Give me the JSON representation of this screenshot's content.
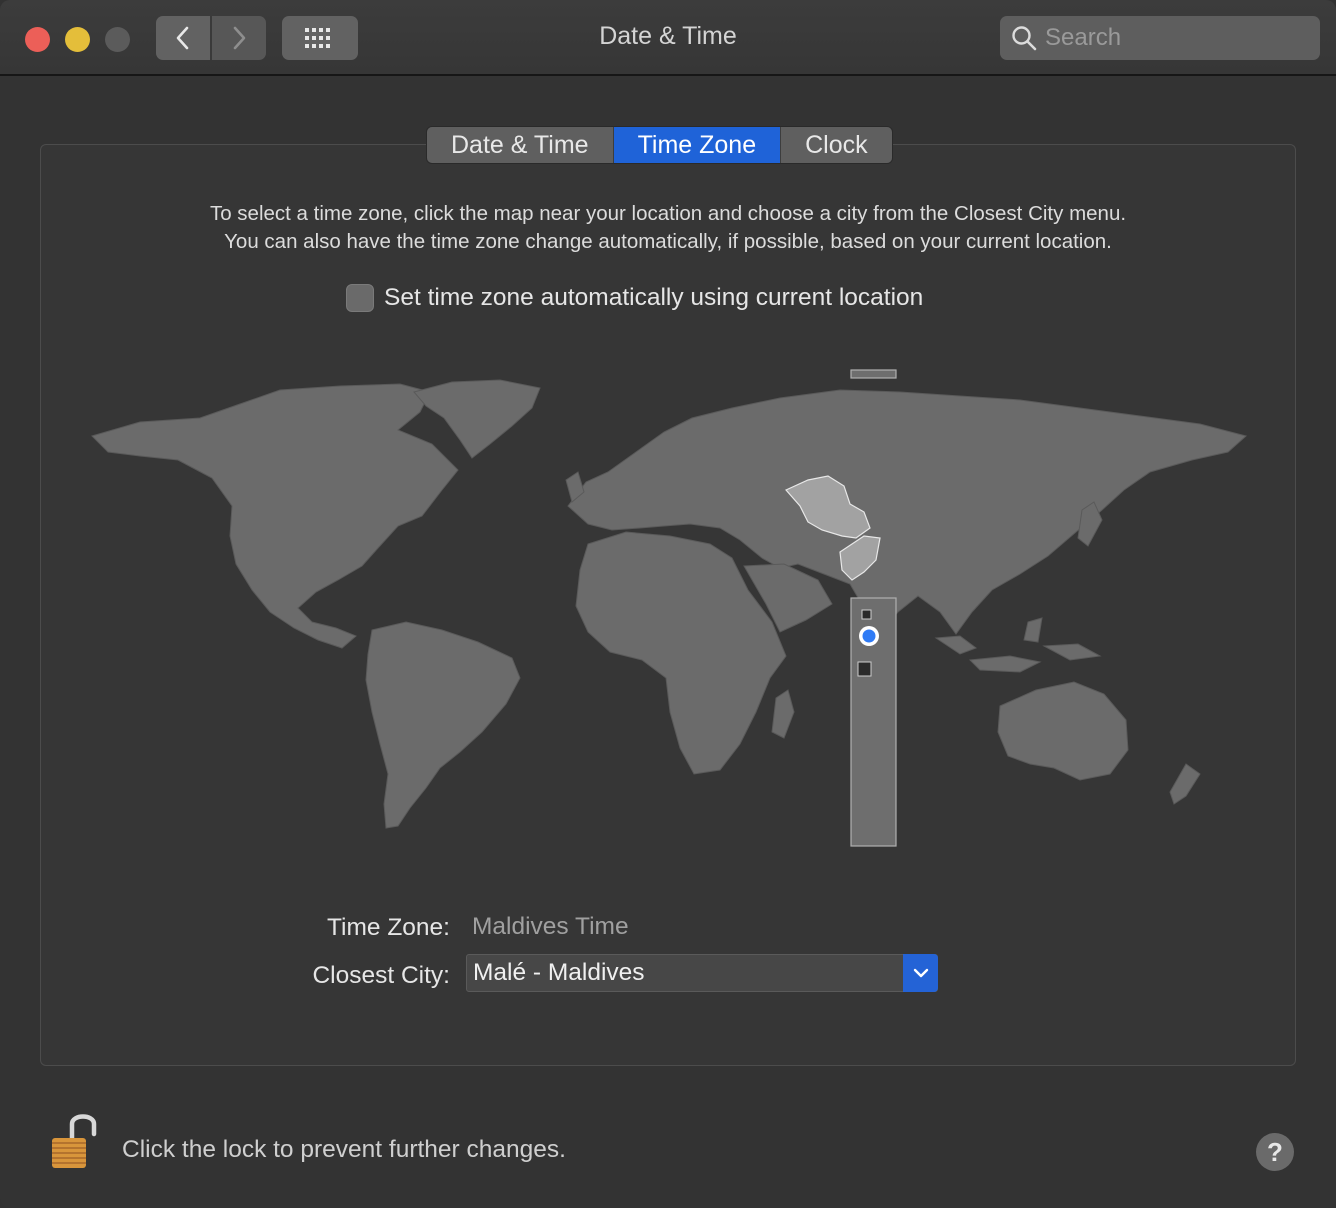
{
  "window": {
    "title": "Date & Time"
  },
  "toolbar": {
    "search_placeholder": "Search"
  },
  "tabs": [
    {
      "label": "Date & Time",
      "active": false
    },
    {
      "label": "Time Zone",
      "active": true
    },
    {
      "label": "Clock",
      "active": false
    }
  ],
  "instructions": {
    "line1": "To select a time zone, click the map near your location and choose a city from the Closest City menu.",
    "line2": "You can also have the time zone change automatically, if possible, based on your current location."
  },
  "auto_timezone": {
    "label": "Set time zone automatically using current location",
    "checked": false
  },
  "fields": {
    "time_zone_label": "Time Zone:",
    "time_zone_value": "Maldives Time",
    "closest_city_label": "Closest City:",
    "closest_city_value": "Malé - Maldives"
  },
  "footer": {
    "lock_text": "Click the lock to prevent further changes.",
    "help_label": "?"
  },
  "colors": {
    "accent": "#1f63d8",
    "close": "#ec5f58",
    "minimize": "#e4be3a",
    "zoom_disabled": "#5b5b5b",
    "land": "#6b6b6b",
    "selected_region": "#9a9a9a",
    "marker": "#2f7bf5"
  },
  "icons": {
    "back": "chevron-left-icon",
    "forward": "chevron-right-icon",
    "grid": "grid-icon",
    "search": "search-icon",
    "combo": "chevron-down-icon",
    "lock": "unlocked-padlock-icon",
    "location": "location-pin-icon"
  }
}
